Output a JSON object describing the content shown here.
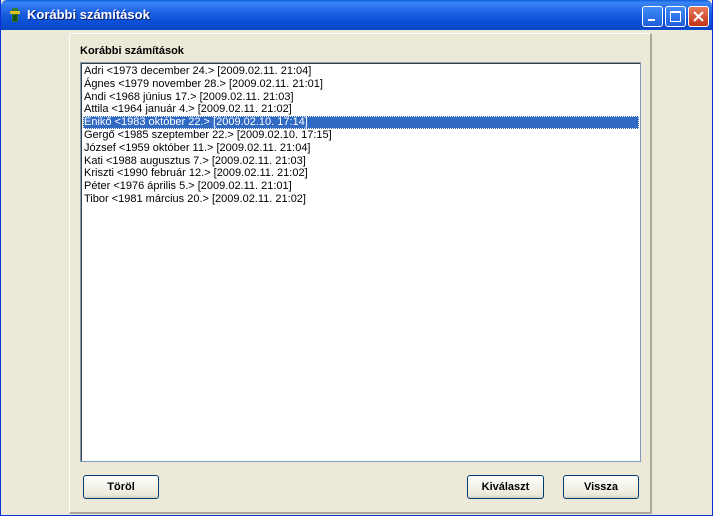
{
  "window": {
    "title": "Korábbi számítások",
    "icon": "app-icon"
  },
  "group": {
    "label": "Korábbi számítások"
  },
  "list": {
    "selected_index": 4,
    "items": [
      "Adri <1973 december 24.> [2009.02.11. 21:04]",
      "Ágnes <1979 november 28.> [2009.02.11. 21:01]",
      "Andi <1968 június 17.> [2009.02.11. 21:03]",
      "Attila <1964 január 4.> [2009.02.11. 21:02]",
      "Enikő <1983 október 22.> [2009.02.10. 17:14]",
      "Gergő <1985 szeptember 22.> [2009.02.10. 17:15]",
      "József <1959 október 11.> [2009.02.11. 21:04]",
      "Kati <1988 augusztus 7.> [2009.02.11. 21:03]",
      "Kriszti <1990 február 12.> [2009.02.11. 21:02]",
      "Péter <1976 április 5.> [2009.02.11. 21:01]",
      "Tibor <1981 március 20.> [2009.02.11. 21:02]"
    ]
  },
  "buttons": {
    "delete": "Töröl",
    "select": "Kiválaszt",
    "back": "Vissza"
  },
  "colors": {
    "titlebar": "#0a5bdb",
    "selection": "#316ac5",
    "close_button": "#c2351a"
  }
}
